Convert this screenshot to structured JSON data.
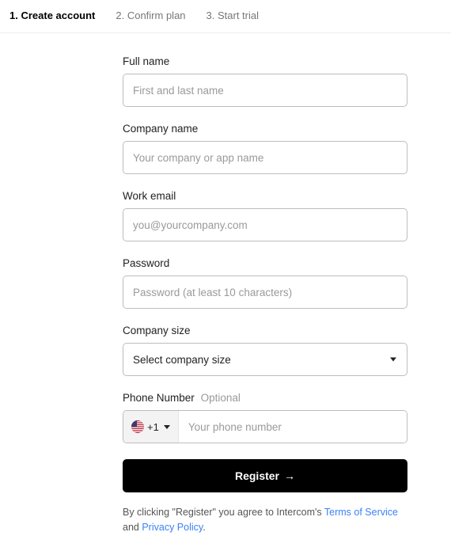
{
  "steps": {
    "step1": "1. Create account",
    "step2": "2. Confirm plan",
    "step3": "3. Start trial"
  },
  "form": {
    "full_name": {
      "label": "Full name",
      "placeholder": "First and last name"
    },
    "company_name": {
      "label": "Company name",
      "placeholder": "Your company or app name"
    },
    "work_email": {
      "label": "Work email",
      "placeholder": "you@yourcompany.com"
    },
    "password": {
      "label": "Password",
      "placeholder": "Password (at least 10 characters)"
    },
    "company_size": {
      "label": "Company size",
      "selected": "Select company size"
    },
    "phone": {
      "label": "Phone Number",
      "optional": "Optional",
      "dial_code": "+1",
      "placeholder": "Your phone number"
    }
  },
  "register": {
    "label": "Register"
  },
  "agree": {
    "prefix": "By clicking \"Register\" you agree to Intercom's ",
    "tos": "Terms of Service",
    "mid": " and ",
    "privacy": "Privacy Policy",
    "suffix": "."
  }
}
